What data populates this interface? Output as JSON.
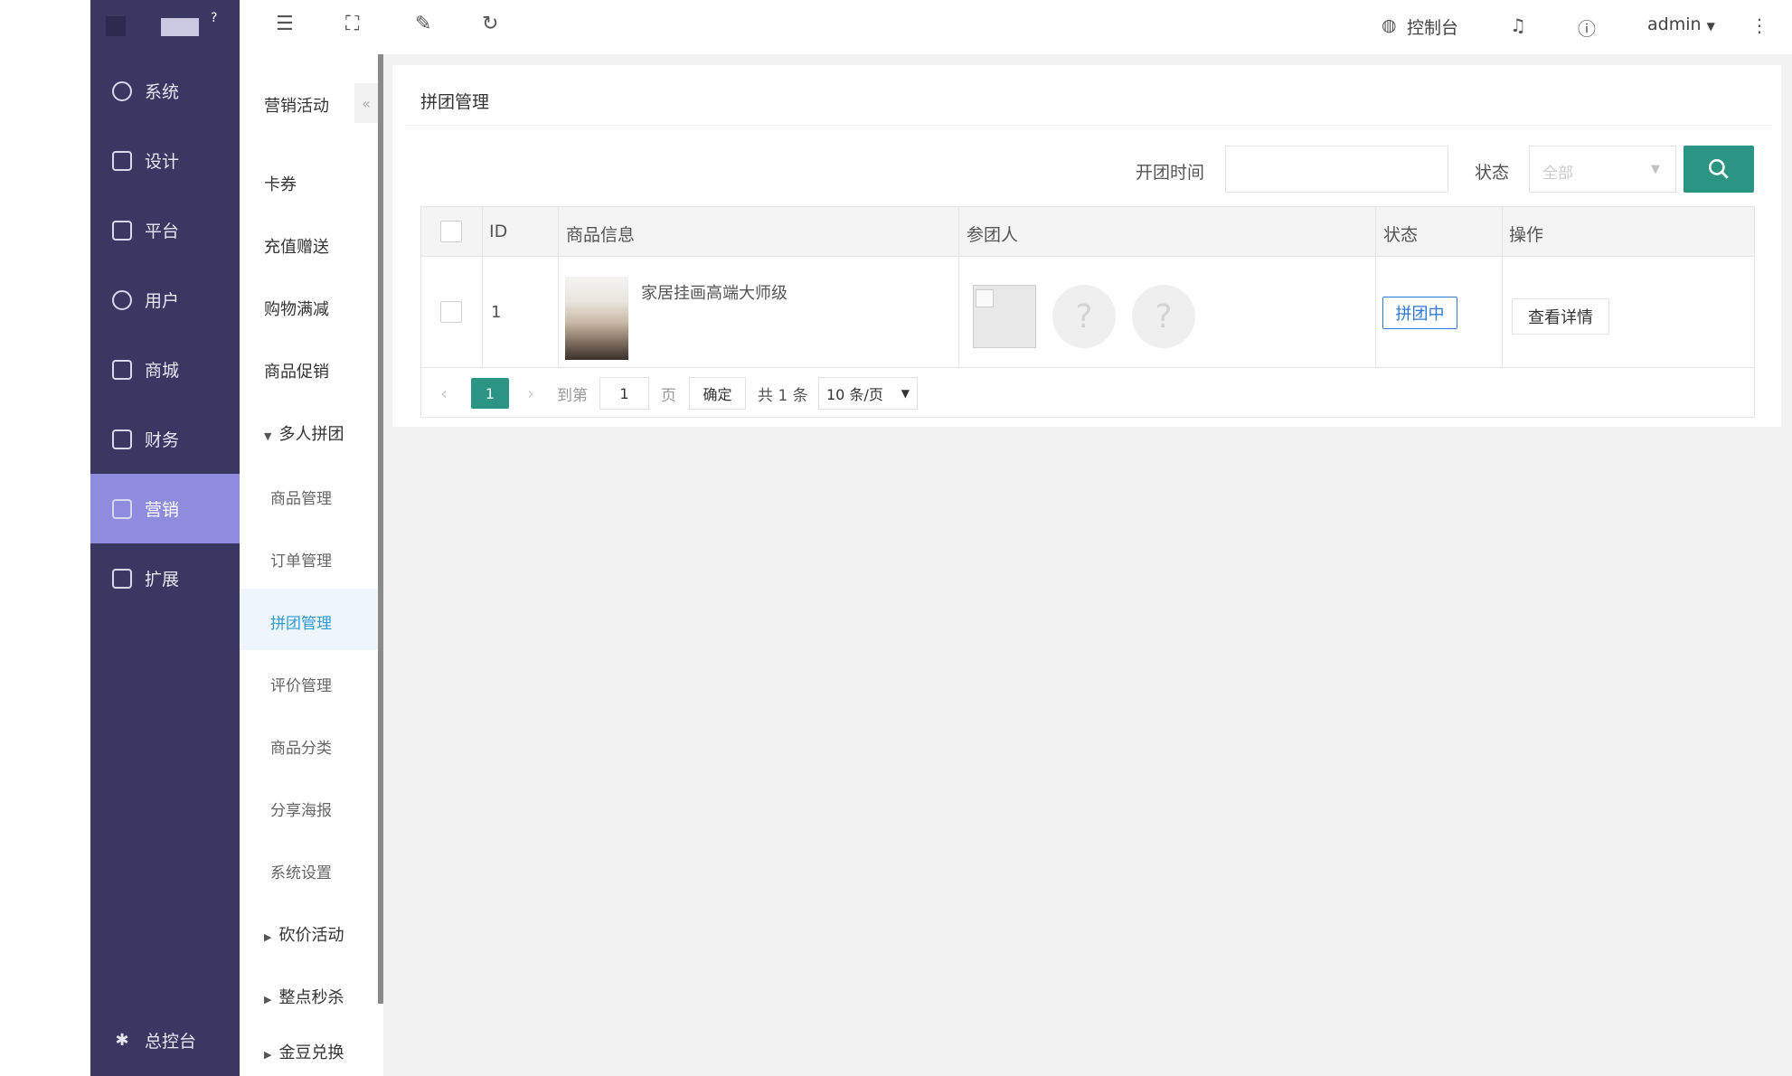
{
  "topbar": {
    "console_label": "控制台",
    "user_name": "admin"
  },
  "main_nav": [
    {
      "label": "系统",
      "icon": "gear-icon"
    },
    {
      "label": "设计",
      "icon": "design-icon"
    },
    {
      "label": "平台",
      "icon": "platform-icon"
    },
    {
      "label": "用户",
      "icon": "user-icon"
    },
    {
      "label": "商城",
      "icon": "store-icon"
    },
    {
      "label": "财务",
      "icon": "finance-icon"
    },
    {
      "label": "营销",
      "icon": "gift-icon"
    },
    {
      "label": "扩展",
      "icon": "apps-icon"
    }
  ],
  "main_nav_bottom": {
    "label": "总控台"
  },
  "sub_nav": {
    "items": [
      "营销活动",
      "卡券",
      "充值赠送",
      "购物满减",
      "商品促销",
      "多人拼团"
    ],
    "group_children": [
      "商品管理",
      "订单管理",
      "拼团管理",
      "评价管理",
      "商品分类",
      "分享海报",
      "系统设置"
    ],
    "more": [
      "砍价活动",
      "整点秒杀",
      "金豆兑换"
    ]
  },
  "page": {
    "title": "拼团管理",
    "filter_time_label": "开团时间",
    "filter_status_label": "状态",
    "filter_status_placeholder": "全部"
  },
  "table": {
    "headers": [
      "ID",
      "商品信息",
      "参团人",
      "状态",
      "操作"
    ],
    "rows": [
      {
        "id": "1",
        "product": "家居挂画高端大师级",
        "avatar_placeholder": "?",
        "status": "拼团中",
        "action": "查看详情"
      }
    ]
  },
  "pagination": {
    "current": "1",
    "goto_label": "到第",
    "goto_value": "1",
    "page_unit": "页",
    "confirm": "确定",
    "total": "共 1 条",
    "page_size": "10 条/页"
  },
  "colors": {
    "sidebar_bg": "#3a3863",
    "sidebar_active": "#8f8ce0",
    "primary": "#2b9483",
    "active_link": "#2f9ad6"
  }
}
